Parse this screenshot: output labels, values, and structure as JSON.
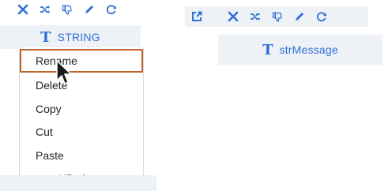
{
  "left_panel": {
    "toolbar": {
      "icons": [
        "close-icon",
        "shuffle-icon",
        "thumbs-down-icon",
        "pencil-icon",
        "refresh-icon"
      ]
    },
    "node": {
      "type_glyph": "T",
      "label": "STRING"
    },
    "context_menu": {
      "items": [
        "Rename",
        "Delete",
        "Copy",
        "Cut",
        "Paste",
        "copyXPath"
      ],
      "highlighted": "Rename"
    }
  },
  "right_panel": {
    "toolbar": {
      "icons": [
        "open-external-icon",
        "close-icon",
        "shuffle-icon",
        "thumbs-down-icon",
        "pencil-icon",
        "refresh-icon"
      ]
    },
    "node": {
      "type_glyph": "T",
      "label": "strMessage"
    }
  },
  "colors": {
    "accent": "#2f6fd6",
    "highlight_border": "#c0642c",
    "panel_bg": "#eef1f6"
  }
}
